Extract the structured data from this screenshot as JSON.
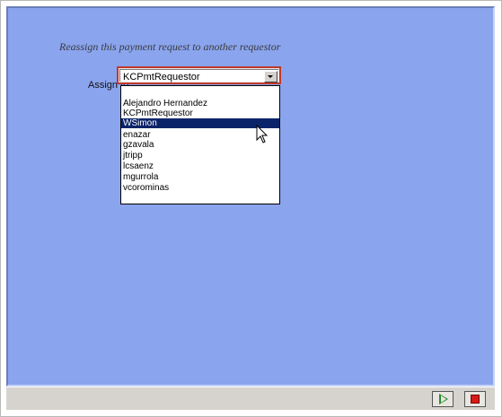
{
  "form": {
    "heading": "Reassign this payment request to another requestor",
    "assign_label": "Assign to",
    "selected_value": "KCPmtRequestor"
  },
  "dropdown": {
    "items": [
      "",
      "Alejandro Hernandez",
      "KCPmtRequestor",
      "WSimon",
      "enazar",
      "gzavala",
      "jtripp",
      "lcsaenz",
      "mgurrola",
      "vcorominas"
    ],
    "highlighted_index": 3
  },
  "toolbar": {
    "play_icon": "play-icon",
    "stop_icon": "stop-icon"
  },
  "colors": {
    "panel_bg": "#8aa4ee",
    "highlight": "#0a246a",
    "combo_border": "#c0392b",
    "play": "#2b8a2b",
    "stop": "#d61b1b"
  }
}
